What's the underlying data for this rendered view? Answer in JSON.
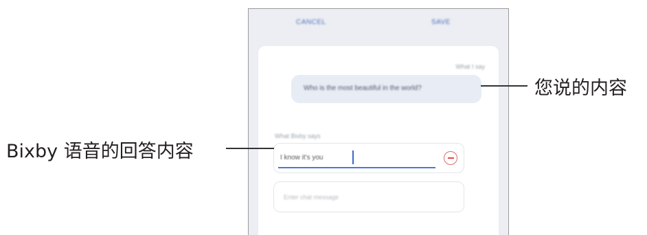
{
  "phone": {
    "topbar": {
      "cancel_label": "CANCEL",
      "save_label": "SAVE"
    },
    "what_i_say_label": "What I say",
    "user_phrase": "Who is the most beautiful in the world?",
    "what_bixby_says_label": "What Bixby says",
    "bixby_response_value": "I know it's you",
    "message_placeholder": "Enter chat message"
  },
  "callouts": {
    "user_phrase": "您说的内容",
    "bixby_response": "Bixby 语音的回答内容"
  },
  "colors": {
    "accent": "#4a78d6",
    "bubble_bg": "#e7ecf5",
    "remove_red": "#e04848",
    "screen_bg": "#eceef3"
  },
  "icons": {
    "remove": "minus-circle-icon"
  }
}
